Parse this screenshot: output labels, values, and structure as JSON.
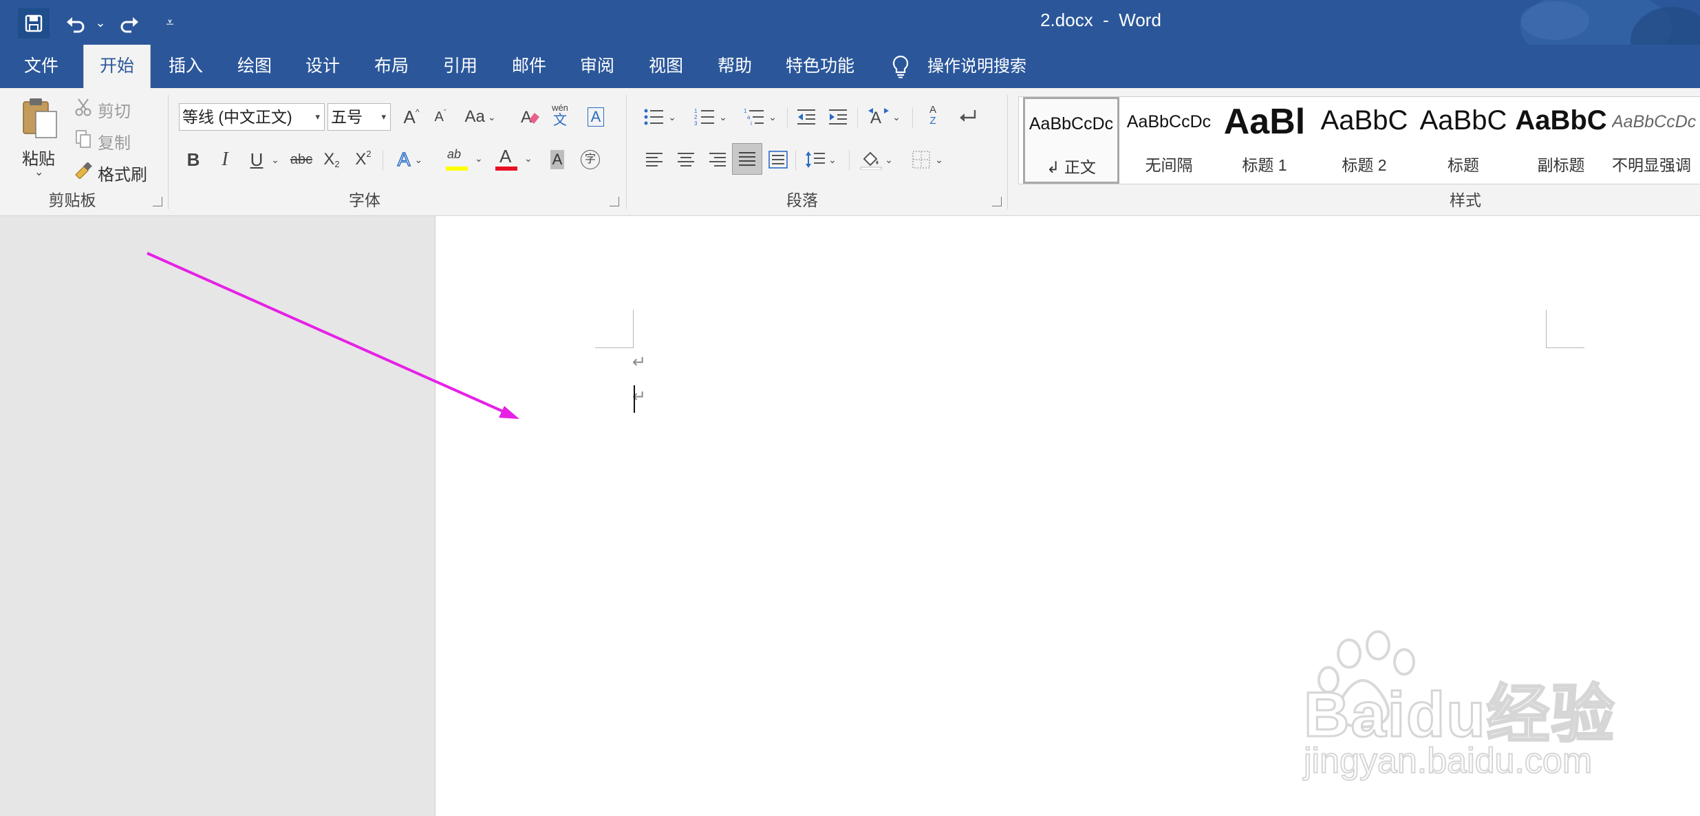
{
  "app": {
    "title": "2.docx  -  Word"
  },
  "colors": {
    "title_bar": "#2b579a",
    "ribbon_bg": "#f3f3f3",
    "font_color_bar": "#e81123",
    "highlight_bar": "#ffff00",
    "annotation_arrow": "#e621e6"
  },
  "qat": {
    "save_icon": "save-icon",
    "undo_icon": "undo-icon",
    "redo_icon": "redo-icon",
    "customize_icon": "customize-qat-icon",
    "dd": "⌄",
    "customize_glyph": "⩡"
  },
  "tabs": [
    {
      "label": "文件"
    },
    {
      "label": "开始",
      "active": true
    },
    {
      "label": "插入"
    },
    {
      "label": "绘图"
    },
    {
      "label": "设计"
    },
    {
      "label": "布局"
    },
    {
      "label": "引用"
    },
    {
      "label": "邮件"
    },
    {
      "label": "审阅"
    },
    {
      "label": "视图"
    },
    {
      "label": "帮助"
    },
    {
      "label": "特色功能"
    }
  ],
  "tell_me": {
    "label": "操作说明搜索",
    "icon": "lightbulb-icon"
  },
  "clipboard": {
    "group_label": "剪贴板",
    "paste_label": "粘贴",
    "paste_dd": "⌄",
    "cut_label": "剪切",
    "copy_label": "复制",
    "format_painter_label": "格式刷"
  },
  "font": {
    "group_label": "字体",
    "font_name": "等线 (中文正文)",
    "font_size": "五号",
    "combo_arrow": "▾",
    "grow": "A",
    "shrink": "A",
    "case": "Aa",
    "dd": "⌄",
    "bold": "B",
    "italic": "I",
    "underline": "U",
    "strike": "abc",
    "subscript_base": "X",
    "subscript_mark": "2",
    "superscript_base": "X",
    "superscript_mark": "2",
    "effects": "A",
    "highlight": "ab",
    "font_color": "A",
    "shading": "A",
    "enclose": "字",
    "phonetic_top": "wén",
    "phonetic_bottom": "文",
    "border_char": "A"
  },
  "paragraph": {
    "group_label": "段落",
    "dd": "⌄",
    "sort_top": "A",
    "sort_bottom": "Z"
  },
  "styles": {
    "group_label": "样式",
    "items": [
      {
        "preview": "AaBbCcDc",
        "name": "↲ 正文",
        "selected": true
      },
      {
        "preview": "AaBbCcDc",
        "name": "无间隔"
      },
      {
        "preview": "AaBl",
        "name": "标题 1"
      },
      {
        "preview": "AaBbC",
        "name": "标题 2"
      },
      {
        "preview": "AaBbC",
        "name": "标题"
      },
      {
        "preview": "AaBbC",
        "name": "副标题"
      },
      {
        "preview": "AaBbCcDc",
        "name": "不明显强调"
      }
    ]
  },
  "document": {
    "paragraph_mark": "↵"
  },
  "watermark": {
    "logo_text": "Baidu经验",
    "url": "jingyan.baidu.com"
  }
}
